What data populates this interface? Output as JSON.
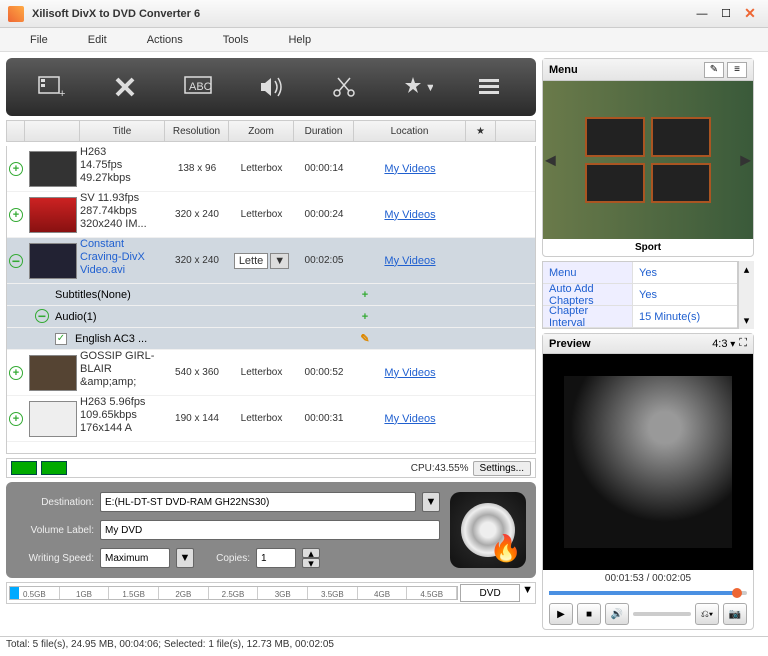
{
  "window": {
    "title": "Xilisoft DivX to DVD Converter 6"
  },
  "menu": [
    "File",
    "Edit",
    "Actions",
    "Tools",
    "Help"
  ],
  "columns": {
    "title": "Title",
    "resolution": "Resolution",
    "zoom": "Zoom",
    "duration": "Duration",
    "location": "Location",
    "fav": "★"
  },
  "files": [
    {
      "title1": "H263",
      "title2": "14.75fps",
      "title3": "49.27kbps",
      "res": "138 x 96",
      "zoom": "Letterbox",
      "dur": "00:00:14",
      "loc": "My Videos",
      "sel": false
    },
    {
      "title1": "SV 11.93fps",
      "title2": "287.74kbps",
      "title3": "320x240 IM...",
      "res": "320 x 240",
      "zoom": "Letterbox",
      "dur": "00:00:24",
      "loc": "My Videos",
      "sel": false
    },
    {
      "title1": "Constant",
      "title2": "Craving-DivX",
      "title3": "Video.avi",
      "res": "320 x 240",
      "zoom": "Lette",
      "dur": "00:02:05",
      "loc": "My Videos",
      "sel": true
    },
    {
      "title1": "GOSSIP GIRL-",
      "title2": "BLAIR",
      "title3": "&amp;amp;",
      "res": "540 x 360",
      "zoom": "Letterbox",
      "dur": "00:00:52",
      "loc": "My Videos",
      "sel": false
    },
    {
      "title1": "H263 5.96fps",
      "title2": "109.65kbps",
      "title3": "176x144 A",
      "res": "190 x 144",
      "zoom": "Letterbox",
      "dur": "00:00:31",
      "loc": "My Videos",
      "sel": false
    }
  ],
  "sub": {
    "subtitles": "Subtitles(None)",
    "audio": "Audio(1)",
    "audiotrack": "English AC3 ..."
  },
  "cpu": {
    "label": "CPU:43.55%",
    "settings": "Settings..."
  },
  "dest": {
    "dest_label": "Destination:",
    "dest_val": "E:(HL-DT-ST DVD-RAM GH22NS30)",
    "vol_label": "Volume Label:",
    "vol_val": "My DVD",
    "speed_label": "Writing Speed:",
    "speed_val": "Maximum",
    "copies_label": "Copies:",
    "copies_val": "1"
  },
  "sizes": [
    "0.5GB",
    "1GB",
    "1.5GB",
    "2GB",
    "2.5GB",
    "3GB",
    "3.5GB",
    "4GB",
    "4.5GB"
  ],
  "disc_type": "DVD",
  "footer": "Total: 5 file(s), 24.95 MB, 00:04:06; Selected: 1 file(s), 12.73 MB, 00:02:05",
  "menutemplate": {
    "header": "Menu",
    "caption": "Sport"
  },
  "props": [
    {
      "k": "Menu",
      "v": "Yes"
    },
    {
      "k": "Auto Add Chapters",
      "v": "Yes"
    },
    {
      "k": "Chapter Interval",
      "v": "15 Minute(s)"
    }
  ],
  "preview": {
    "header": "Preview",
    "ratio": "4:3",
    "time": "00:01:53 / 00:02:05"
  }
}
